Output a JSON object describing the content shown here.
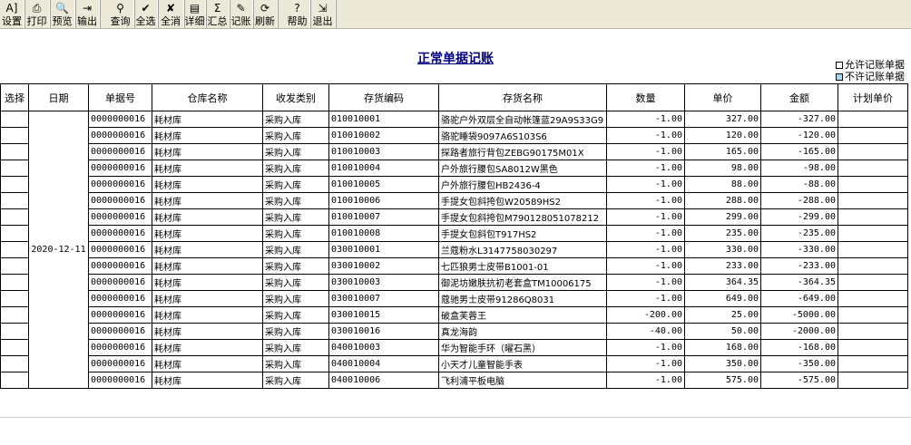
{
  "toolbar": {
    "buttons": [
      {
        "id": "settings",
        "label": "设置",
        "icon": "settings-icon",
        "glyph": "A]"
      },
      {
        "id": "print",
        "label": "打印",
        "icon": "printer-icon",
        "glyph": "⎙"
      },
      {
        "id": "preview",
        "label": "预览",
        "icon": "preview-icon",
        "glyph": "🔍"
      },
      {
        "id": "export",
        "label": "输出",
        "icon": "export-icon",
        "glyph": "⇥"
      },
      {
        "id": "query",
        "label": "查询",
        "icon": "binoculars-icon",
        "glyph": "⚲"
      },
      {
        "id": "select-all",
        "label": "全选",
        "icon": "select-all-icon",
        "glyph": "✔"
      },
      {
        "id": "deselect-all",
        "label": "全消",
        "icon": "deselect-all-icon",
        "glyph": "✘"
      },
      {
        "id": "detail",
        "label": "详细",
        "icon": "detail-icon",
        "glyph": "▤"
      },
      {
        "id": "summary",
        "label": "汇总",
        "icon": "summary-icon",
        "glyph": "Σ"
      },
      {
        "id": "post",
        "label": "记账",
        "icon": "post-icon",
        "glyph": "✎"
      },
      {
        "id": "refresh",
        "label": "刷新",
        "icon": "refresh-icon",
        "glyph": "⟳"
      },
      {
        "id": "help",
        "label": "帮助",
        "icon": "help-icon",
        "glyph": "?"
      },
      {
        "id": "exit",
        "label": "退出",
        "icon": "exit-icon",
        "glyph": "⇲"
      }
    ]
  },
  "page": {
    "title": "正常单据记账"
  },
  "legend": {
    "allow": "允许记账单据",
    "deny": "不许记账单据"
  },
  "table": {
    "headers": [
      "选择",
      "日期",
      "单据号",
      "仓库名称",
      "收发类别",
      "存货编码",
      "存货名称",
      "数量",
      "单价",
      "金额",
      "计划单价"
    ],
    "date": "2020-12-11",
    "rows": [
      {
        "doc": "0000000016",
        "wh": "耗材库",
        "type": "采购入库",
        "code": "010010001",
        "name": "骆驼户外双层全自动帐篷蓝29A9S33G9",
        "qty": "-1.00",
        "price": "327.00",
        "amount": "-327.00"
      },
      {
        "doc": "0000000016",
        "wh": "耗材库",
        "type": "采购入库",
        "code": "010010002",
        "name": "骆驼睡袋9097A6S103S6",
        "qty": "-1.00",
        "price": "120.00",
        "amount": "-120.00"
      },
      {
        "doc": "0000000016",
        "wh": "耗材库",
        "type": "采购入库",
        "code": "010010003",
        "name": "探路者旅行背包ZEBG90175M01X",
        "qty": "-1.00",
        "price": "165.00",
        "amount": "-165.00"
      },
      {
        "doc": "0000000016",
        "wh": "耗材库",
        "type": "采购入库",
        "code": "010010004",
        "name": "户外旅行腰包SA8012W黑色",
        "qty": "-1.00",
        "price": "98.00",
        "amount": "-98.00"
      },
      {
        "doc": "0000000016",
        "wh": "耗材库",
        "type": "采购入库",
        "code": "010010005",
        "name": "户外旅行腰包HB2436-4",
        "qty": "-1.00",
        "price": "88.00",
        "amount": "-88.00"
      },
      {
        "doc": "0000000016",
        "wh": "耗材库",
        "type": "采购入库",
        "code": "010010006",
        "name": "手提女包斜挎包W20589HS2",
        "qty": "-1.00",
        "price": "288.00",
        "amount": "-288.00"
      },
      {
        "doc": "0000000016",
        "wh": "耗材库",
        "type": "采购入库",
        "code": "010010007",
        "name": "手提女包斜挎包M79012805107821​2",
        "qty": "-1.00",
        "price": "299.00",
        "amount": "-299.00"
      },
      {
        "doc": "0000000016",
        "wh": "耗材库",
        "type": "采购入库",
        "code": "010010008",
        "name": "手提女包斜包T917HS2",
        "qty": "-1.00",
        "price": "235.00",
        "amount": "-235.00"
      },
      {
        "doc": "0000000016",
        "wh": "耗材库",
        "type": "采购入库",
        "code": "030010001",
        "name": "兰蔻粉水L3147758030297",
        "qty": "-1.00",
        "price": "330.00",
        "amount": "-330.00"
      },
      {
        "doc": "0000000016",
        "wh": "耗材库",
        "type": "采购入库",
        "code": "030010002",
        "name": "七匹狼男士皮带B1001-01",
        "qty": "-1.00",
        "price": "233.00",
        "amount": "-233.00"
      },
      {
        "doc": "0000000016",
        "wh": "耗材库",
        "type": "采购入库",
        "code": "030010003",
        "name": "御泥坊嫩肤抗初老套盒TM10006175",
        "qty": "-1.00",
        "price": "364.35",
        "amount": "-364.35"
      },
      {
        "doc": "0000000016",
        "wh": "耗材库",
        "type": "采购入库",
        "code": "030010007",
        "name": "蔻驰男士皮带91286Q8031",
        "qty": "-1.00",
        "price": "649.00",
        "amount": "-649.00"
      },
      {
        "doc": "0000000016",
        "wh": "耗材库",
        "type": "采购入库",
        "code": "030010015",
        "name": "破盒芙蓉王",
        "qty": "-200.00",
        "price": "25.00",
        "amount": "-5000.00"
      },
      {
        "doc": "0000000016",
        "wh": "耗材库",
        "type": "采购入库",
        "code": "030010016",
        "name": "真龙海韵",
        "qty": "-40.00",
        "price": "50.00",
        "amount": "-2000.00"
      },
      {
        "doc": "0000000016",
        "wh": "耗材库",
        "type": "采购入库",
        "code": "040010003",
        "name": "华为智能手环（曜石黑）",
        "qty": "-1.00",
        "price": "168.00",
        "amount": "-168.00"
      },
      {
        "doc": "0000000016",
        "wh": "耗材库",
        "type": "采购入库",
        "code": "040010004",
        "name": "小天才儿童智能手表",
        "qty": "-1.00",
        "price": "350.00",
        "amount": "-350.00"
      },
      {
        "doc": "0000000016",
        "wh": "耗材库",
        "type": "采购入库",
        "code": "040010006",
        "name": "飞利浦平板电脑",
        "qty": "-1.00",
        "price": "575.00",
        "amount": "-575.00"
      }
    ]
  }
}
